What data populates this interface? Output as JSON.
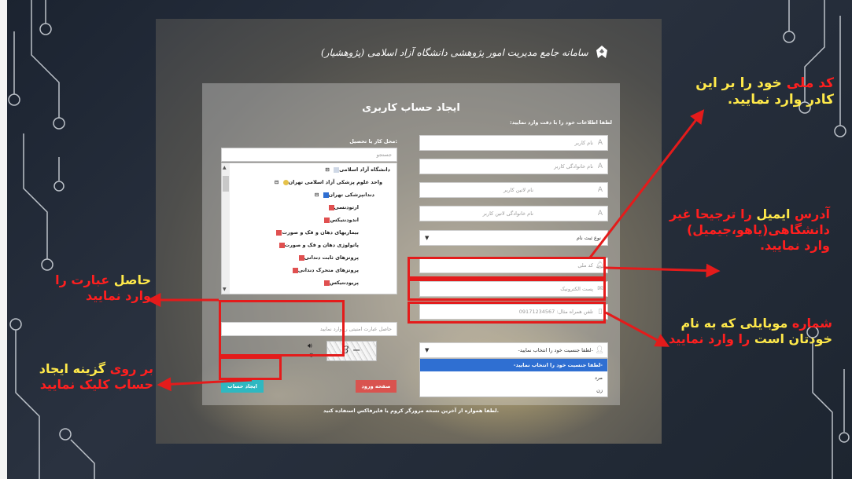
{
  "banner": {
    "text": "سامانه جامع مدیریت امور پژوهشی دانشگاه آزاد اسلامی (پژوهشیار)",
    "logo_icon": "university-logo-icon"
  },
  "form": {
    "title": "ایجاد حساب کاربری",
    "instruction": "لطفا اطلاعات خود را با دقت وارد نمایید:",
    "fields": {
      "first_name": "نام کاربر",
      "last_name": "نام خانوادگی کاربر",
      "first_name_latin": "نام لاتین کاربر",
      "last_name_latin": "نام خانوادگی لاتین کاربر",
      "registration_type": "نوع ثبت نام",
      "national_code": "کد ملی",
      "email": "پست الکترونیک",
      "mobile": "تلفن همراه مثال: 09171234567",
      "gender": "-لطفا جنسیت خود را انتخاب نمایید-"
    },
    "gender_options": [
      "-لطفا جنسیت خود را انتخاب نمایید-",
      "مرد",
      "زن"
    ],
    "workplace_label": "محل کار یا تحصیل:",
    "tree_search_placeholder": "جستجو",
    "tree_items": [
      "دانشگاه آزاد اسلامی",
      "واحد علوم پزشکی آزاد اسلامی تهران",
      "دندانپزشکی تهران",
      "ارتودنسی",
      "اندودنتیکس",
      "بیماریهای دهان و فک و صورت",
      "پاتولوژی دهان و فک و صورت",
      "پروتزهای ثابت دندانی",
      "پروتزهای متحرک دندانی",
      "پریودنتیکس"
    ],
    "captcha_placeholder": "حاصل عبارت امنیتی را وارد نمایید",
    "captcha_text": "3 −",
    "create_button": "ایجاد حساب",
    "login_button": "صفحه ورود",
    "footnote": "لطفا همواره از آخرین نسخه مرورگر کروم یا فایرفاکس استفاده کنید."
  },
  "annotations": {
    "national_code": {
      "w1": "کد ملی",
      "w2": "خود را بر این کادر وارد نمایید."
    },
    "email": {
      "w1": "آدرس",
      "w2": "ایمیل",
      "w3": "را ترجیحا غیر دانشگاهی(یاهو،جیمیل) وارد نمایید."
    },
    "mobile": {
      "w1": "شماره",
      "w2": "موبایلی که به نام",
      "w3": "خودتان است",
      "w4": "را وارد نمایید"
    },
    "captcha": {
      "w1": "حاصل",
      "w2": "عبارت را وارد نمایید"
    },
    "create": {
      "w1": "بر روی",
      "w2": "گزینه",
      "w3": "ایجاد",
      "w4": "حساب کلیک نمایید"
    }
  },
  "colors": {
    "highlight": "#e41b1b",
    "create_button": "#2fb8c1",
    "login_button": "#d9534f",
    "annotation_yellow": "#ffe94a",
    "annotation_red": "#ff1f1f"
  }
}
